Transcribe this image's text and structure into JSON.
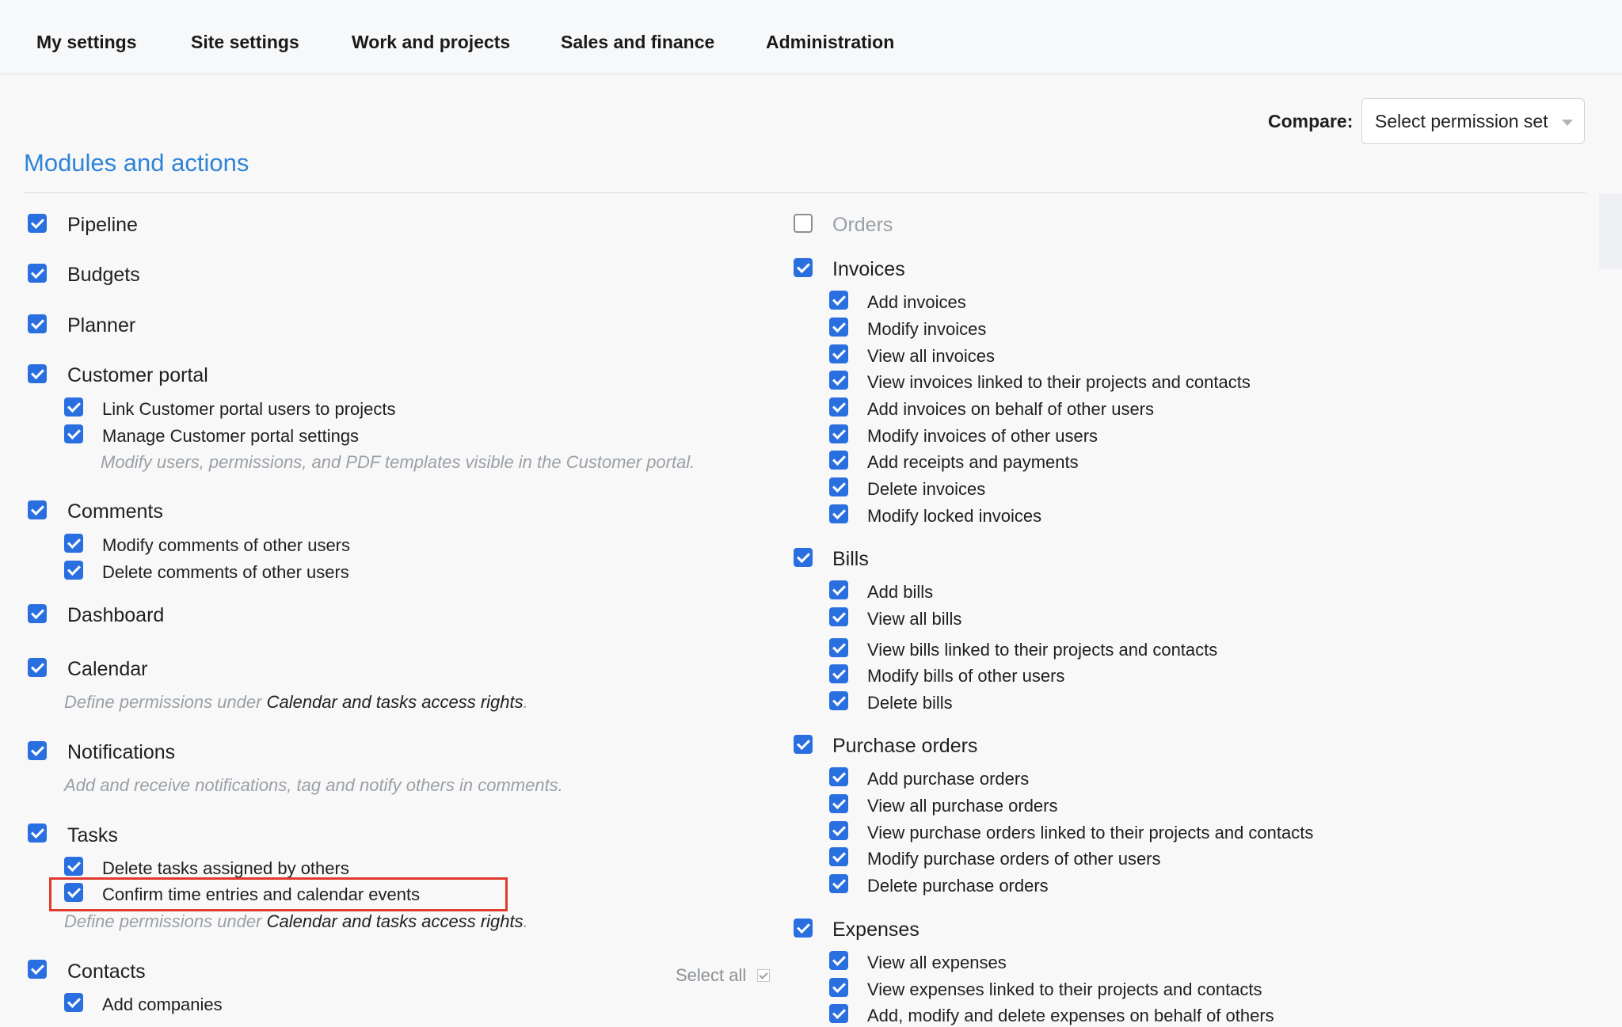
{
  "nav": {
    "tabs": [
      "My settings",
      "Site settings",
      "Work and projects",
      "Sales and finance",
      "Administration"
    ]
  },
  "compare": {
    "label": "Compare:",
    "select_value": "Select permission set"
  },
  "section_title": "Modules and actions",
  "left": {
    "pipeline": "Pipeline",
    "budgets": "Budgets",
    "planner": "Planner",
    "customer_portal": "Customer portal",
    "cp_link": "Link Customer portal users to projects",
    "cp_manage": "Manage Customer portal settings",
    "cp_hint": "Modify users, permissions, and PDF templates visible in the Customer portal.",
    "comments": "Comments",
    "comments_modify": "Modify comments of other users",
    "comments_delete": "Delete comments of other users",
    "dashboard": "Dashboard",
    "calendar": "Calendar",
    "calendar_hint_prefix": "Define permissions under ",
    "calendar_hint_link": "Calendar and tasks access rights",
    "calendar_hint_suffix": ".",
    "notifications": "Notifications",
    "notifications_hint": "Add and receive notifications, tag and notify others in comments.",
    "tasks": "Tasks",
    "tasks_delete": "Delete tasks assigned by others",
    "tasks_confirm": "Confirm time entries and calendar events",
    "tasks_hint_prefix": "Define permissions under ",
    "tasks_hint_link": "Calendar and tasks access rights",
    "tasks_hint_suffix": ".",
    "contacts": "Contacts",
    "select_all": "Select all",
    "contacts_add": "Add companies"
  },
  "right": {
    "orders": "Orders",
    "invoices": "Invoices",
    "invoices_items": [
      "Add invoices",
      "Modify invoices",
      "View all invoices",
      "View invoices linked to their projects and contacts",
      "Add invoices on behalf of other users",
      "Modify invoices of other users",
      "Add receipts and payments",
      "Delete invoices",
      "Modify locked invoices"
    ],
    "bills": "Bills",
    "bills_items": [
      "Add bills",
      "View all bills",
      "View bills linked to their projects and contacts",
      "Modify bills of other users",
      "Delete bills"
    ],
    "purchase_orders": "Purchase orders",
    "po_items": [
      "Add purchase orders",
      "View all purchase orders",
      "View purchase orders linked to their projects and contacts",
      "Modify purchase orders of other users",
      "Delete purchase orders"
    ],
    "expenses": "Expenses",
    "expenses_items": [
      "View all expenses",
      "View expenses linked to their projects and contacts",
      "Add, modify and delete expenses on behalf of others"
    ]
  },
  "colors": {
    "accent": "#2f84d6",
    "checkbox": "#2a6fe0",
    "highlight": "#e03b2e"
  }
}
